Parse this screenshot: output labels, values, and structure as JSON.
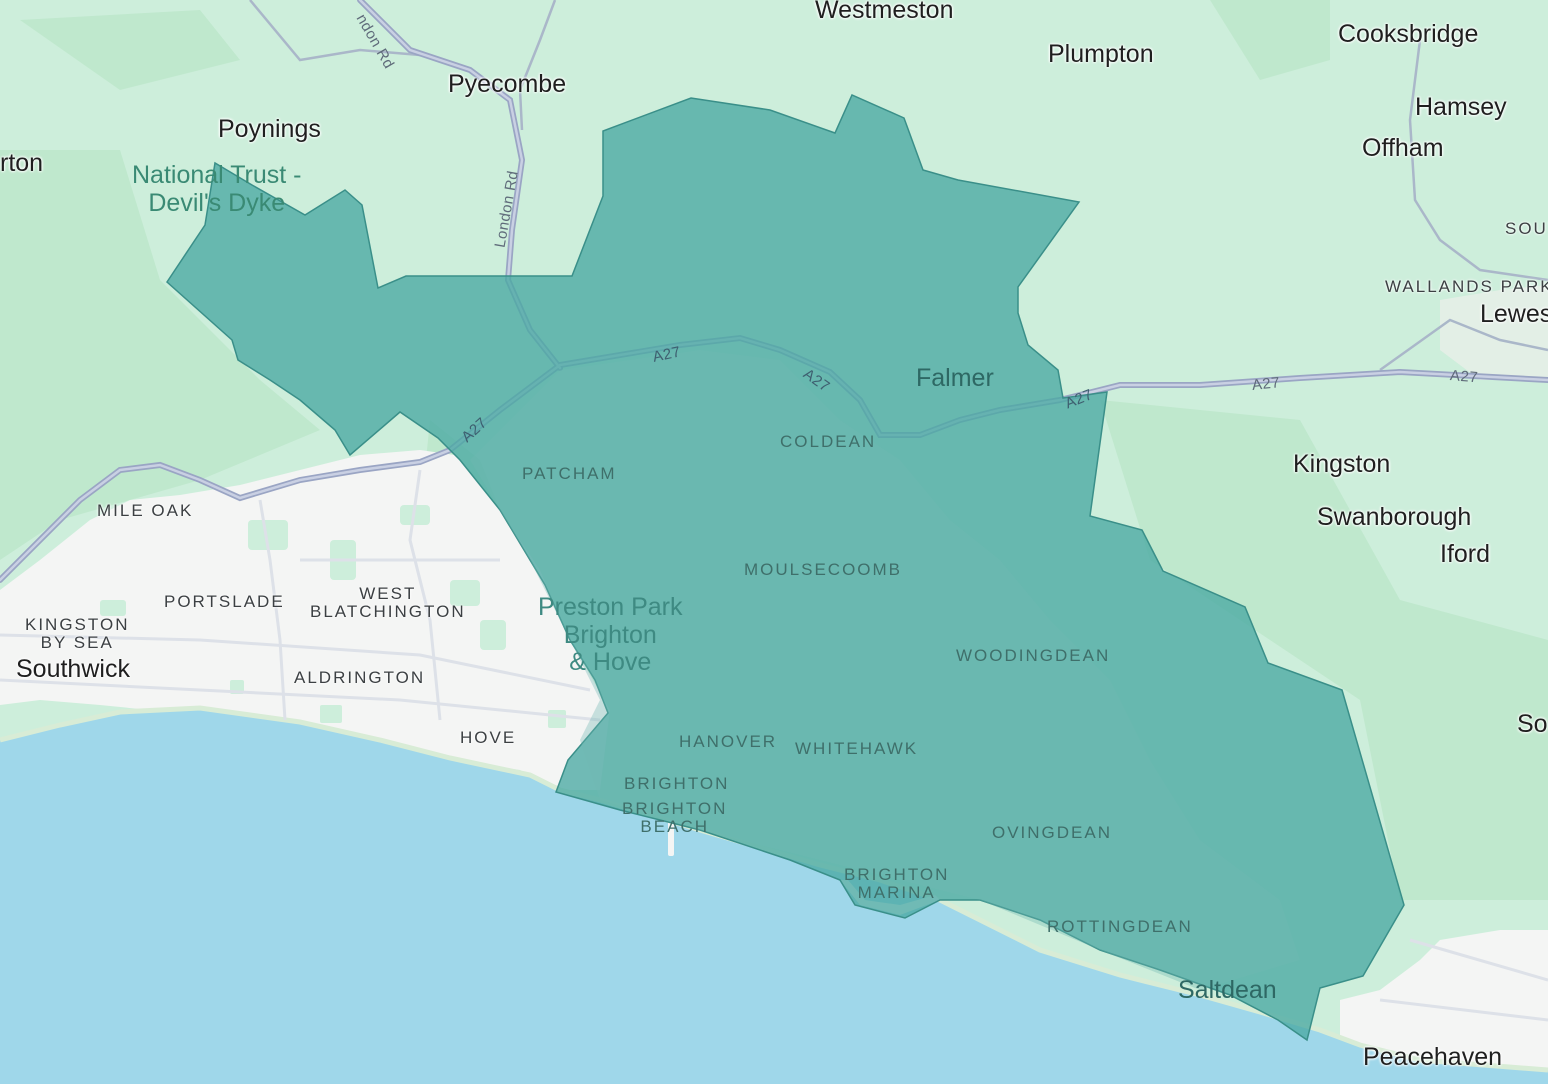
{
  "map": {
    "colors": {
      "land": "#cdeedb",
      "forest": "#b9e6c8",
      "urban": "#f4f5f4",
      "sea": "#9fd7ea",
      "region_fill": "#4aa9a3",
      "region_stroke": "#3a8f89",
      "road": "#9aa5c4"
    },
    "places": {
      "westmeston": "Westmeston",
      "plumpton": "Plumpton",
      "cooksbridge": "Cooksbridge",
      "pyecombe": "Pyecombe",
      "poynings": "Poynings",
      "hamsey": "Hamsey",
      "offham": "Offham",
      "rton": "rton",
      "south_cut": "SOUT",
      "wallands_park": "WALLANDS PARK",
      "lewes": "Lewes",
      "falmer": "Falmer",
      "kingston": "Kingston",
      "swanborough": "Swanborough",
      "iford": "Iford",
      "so": "So",
      "southwick": "Southwick",
      "saltdean": "Saltdean",
      "peacehaven": "Peacehaven"
    },
    "parks": {
      "devils_dyke_line1": "National Trust -",
      "devils_dyke_line2": "Devil's Dyke",
      "preston_park_line1": "Preston Park",
      "preston_park_line2": "Brighton",
      "preston_park_line3": "& Hove"
    },
    "districts": {
      "mile_oak": "MILE OAK",
      "portslade": "PORTSLADE",
      "west_blatchington_line1": "WEST",
      "west_blatchington_line2": "BLATCHINGTON",
      "kingston_by_sea_line1": "KINGSTON",
      "kingston_by_sea_line2": "BY SEA",
      "aldrington": "ALDRINGTON",
      "hove": "HOVE",
      "patcham": "PATCHAM",
      "coldean": "COLDEAN",
      "moulsecoomb": "MOULSECOOMB",
      "woodingdean": "WOODINGDEAN",
      "hanover": "HANOVER",
      "whitehawk": "WHITEHAWK",
      "brighton": "BRIGHTON",
      "brighton_beach_line1": "BRIGHTON",
      "brighton_beach_line2": "BEACH",
      "brighton_marina_line1": "BRIGHTON",
      "brighton_marina_line2": "MARINA",
      "ovingdean": "OVINGDEAN",
      "rottingdean": "ROTTINGDEAN"
    },
    "roads": {
      "london_rd_top": "ndon Rd",
      "london_rd": "London Rd",
      "a27": "A27"
    }
  }
}
